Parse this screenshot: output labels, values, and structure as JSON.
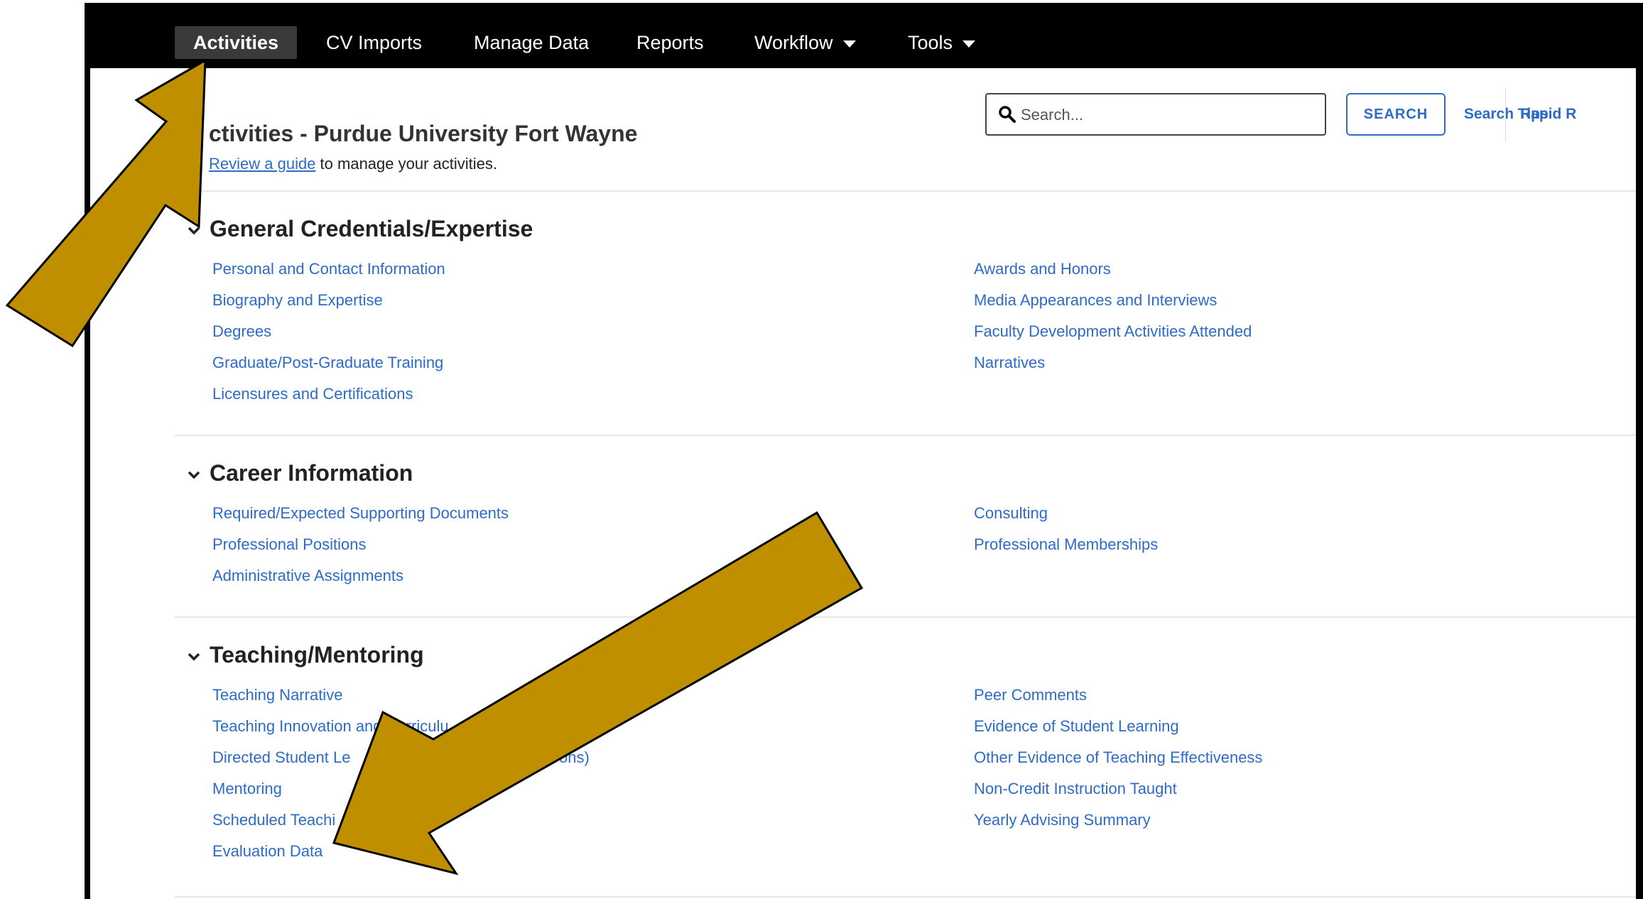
{
  "nav": {
    "items": [
      {
        "label": "Activities"
      },
      {
        "label": "CV Imports"
      },
      {
        "label": "Manage Data"
      },
      {
        "label": "Reports"
      },
      {
        "label": "Workflow"
      },
      {
        "label": "Tools"
      }
    ]
  },
  "header": {
    "title": "ctivities - Purdue University Fort Wayne",
    "guide_link": "Review a guide",
    "guide_suffix": " to manage your activities.",
    "search_placeholder": "Search...",
    "search_button": "SEARCH",
    "search_tips": "Search Tips",
    "rapid_link": "Rapid R"
  },
  "sections": [
    {
      "title": "General Credentials/Expertise",
      "left": [
        "Personal and Contact Information",
        "Biography and Expertise",
        "Degrees",
        "Graduate/Post-Graduate Training",
        "Licensures and Certifications"
      ],
      "right": [
        "Awards and Honors",
        "Media Appearances and Interviews",
        "Faculty Development Activities Attended",
        "Narratives"
      ]
    },
    {
      "title": "Career Information",
      "left": [
        "Required/Expected Supporting Documents",
        "Professional Positions",
        "Administrative Assignments"
      ],
      "right": [
        "Consulting",
        "Professional Memberships"
      ]
    },
    {
      "title": "Teaching/Mentoring",
      "left": [
        "Teaching Narrative",
        "Teaching Innovation and Curriculu",
        "Directed Student Le",
        "Mentoring",
        "Scheduled Teachi",
        "Evaluation Data"
      ],
      "right": [
        "Peer Comments",
        "Evidence of Student Learning",
        "Other Evidence of Teaching Effectiveness",
        "Non-Credit Instruction Taught",
        "Yearly Advising Summary"
      ]
    }
  ],
  "fragments": {
    "directed_tail": "ons)"
  },
  "colors": {
    "link": "#2e6bc6",
    "nav_bg": "#000000",
    "arrow": "#bf8f00"
  }
}
